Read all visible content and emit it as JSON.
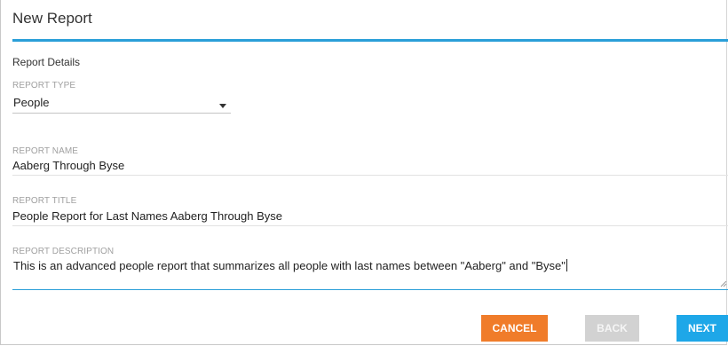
{
  "dialog": {
    "title": "New Report",
    "accent_color": "#2a9fd8"
  },
  "section": {
    "title": "Report Details"
  },
  "report_type": {
    "label": "REPORT TYPE",
    "value": "People",
    "icon": "chevron-down-icon"
  },
  "report_name": {
    "label": "REPORT NAME",
    "value": "Aaberg Through Byse"
  },
  "report_title": {
    "label": "REPORT TITLE",
    "value": "People Report for Last Names Aaberg Through Byse"
  },
  "report_description": {
    "label": "REPORT DESCRIPTION",
    "value": "This is an advanced people report that summarizes all people with last names between \"Aaberg\" and \"Byse\""
  },
  "buttons": {
    "cancel": {
      "label": "CANCEL",
      "color": "#f07c2a"
    },
    "back": {
      "label": "BACK",
      "color": "#d2d2d2",
      "disabled": true
    },
    "next": {
      "label": "NEXT",
      "color": "#1ea7e8"
    }
  }
}
